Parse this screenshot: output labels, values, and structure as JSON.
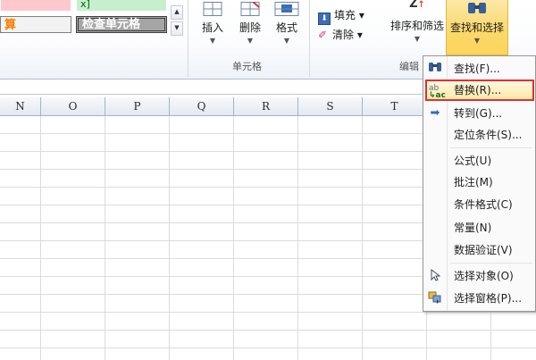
{
  "styles": {
    "top_right_partial": "x]",
    "calc_label": "算",
    "check_cell_label": "检查单元格"
  },
  "cells_group": {
    "insert_label": "插入",
    "delete_label": "删除",
    "format_label": "格式",
    "group_label": "单元格"
  },
  "editing_group": {
    "fill_label": "填充 ▾",
    "clear_label": "清除 ▾",
    "sort_filter_label": "排序和筛选",
    "find_select_label": "查找和选择",
    "group_label": "编辑"
  },
  "columns": [
    "N",
    "O",
    "P",
    "Q",
    "R",
    "S",
    "T"
  ],
  "menu": {
    "items": [
      {
        "label": "查找(F)...",
        "icon": "binoculars-icon"
      },
      {
        "label": "替换(R)...",
        "icon": "replace-icon",
        "highlighted": true
      },
      {
        "label": "转到(G)...",
        "icon": "arrow-right-icon"
      },
      {
        "label": "定位条件(S)...",
        "icon": ""
      },
      {
        "label": "公式(U)",
        "icon": ""
      },
      {
        "label": "批注(M)",
        "icon": ""
      },
      {
        "label": "条件格式(C)",
        "icon": ""
      },
      {
        "label": "常量(N)",
        "icon": ""
      },
      {
        "label": "数据验证(V)",
        "icon": ""
      },
      {
        "label": "选择对象(O)",
        "icon": "cursor-icon"
      },
      {
        "label": "选择窗格(P)...",
        "icon": "selection-pane-icon"
      }
    ]
  },
  "colors": {
    "highlight_border": "#e23030",
    "find_select_active": "#fbd86a",
    "calc_text": "#fa7d00"
  }
}
